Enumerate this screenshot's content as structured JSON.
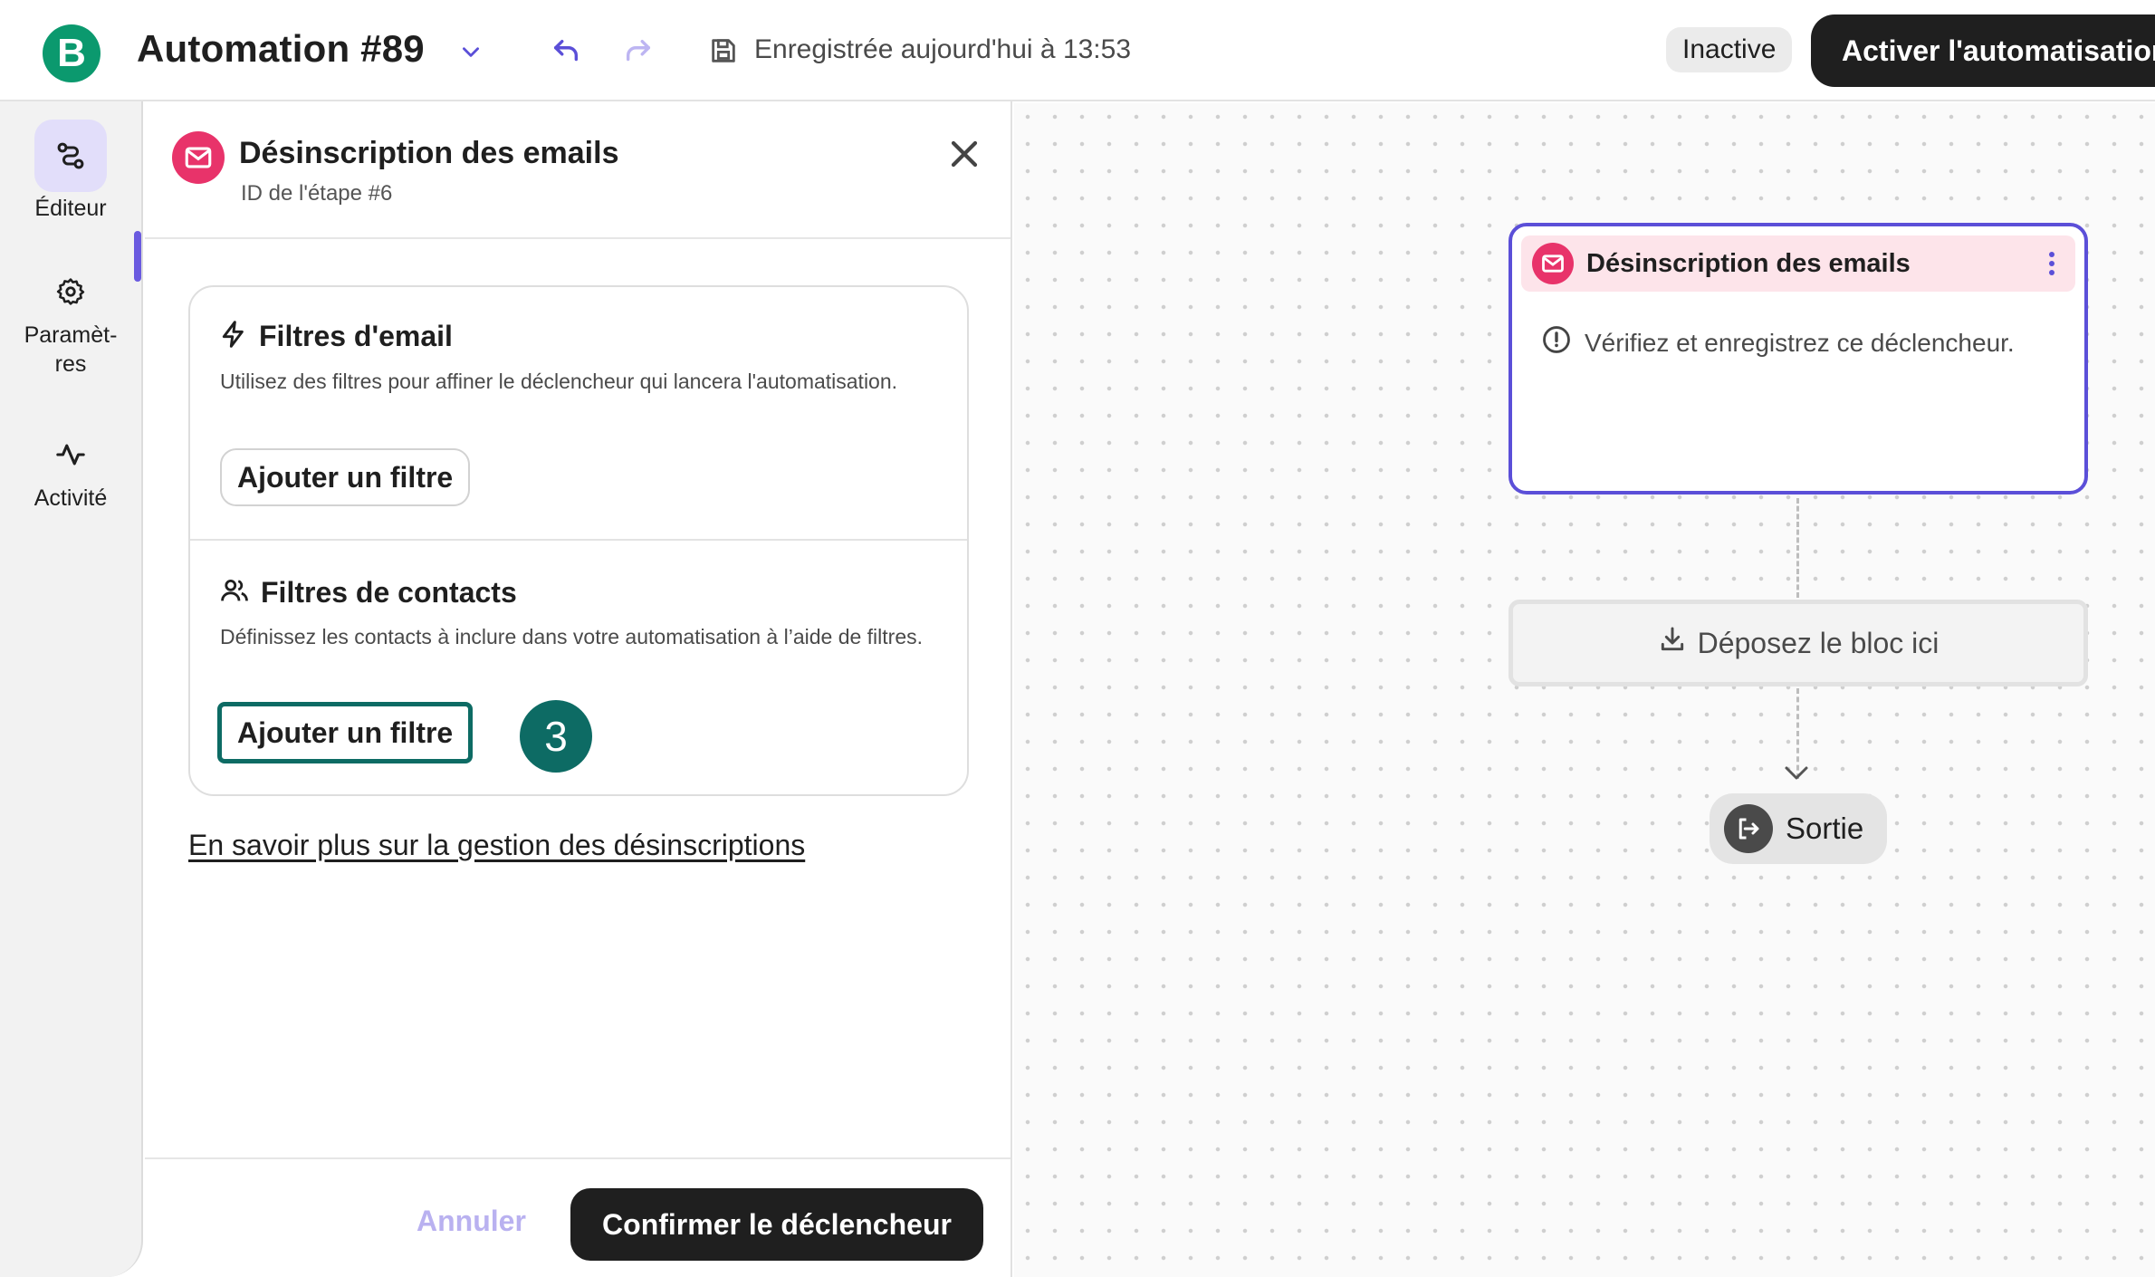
{
  "header": {
    "logo_letter": "B",
    "title": "Automation #89",
    "save_status": "Enregistrée aujourd'hui à 13:53",
    "status_badge": "Inactive",
    "activate_label": "Activer l'automatisation"
  },
  "sidebar": {
    "items": [
      {
        "label": "Éditeur",
        "icon": "workflow-icon",
        "active": true
      },
      {
        "label": "Paramèt-\nres",
        "icon": "gear-icon",
        "active": false
      },
      {
        "label": "Activité",
        "icon": "activity-icon",
        "active": false
      }
    ]
  },
  "panel": {
    "title": "Désinscription des emails",
    "subtitle": "ID de l'étape #6",
    "email_filters": {
      "title": "Filtres d'email",
      "description": "Utilisez des filtres pour affiner le déclencheur qui lancera l'automatisation.",
      "button_label": "Ajouter un filtre"
    },
    "contact_filters": {
      "title": "Filtres de contacts",
      "description": "Définissez les contacts à inclure dans votre automatisation à l’aide de filtres.",
      "button_label": "Ajouter un filtre",
      "step_badge": "3"
    },
    "learn_more_link": "En savoir plus sur la gestion des désinscriptions",
    "cancel_label": "Annuler",
    "confirm_label": "Confirmer le déclencheur"
  },
  "canvas": {
    "trigger_node": {
      "title": "Désinscription des emails",
      "warning": "Vérifiez et enregistrez ce déclencheur."
    },
    "drop_zone_label": "Déposez le bloc ici",
    "exit_label": "Sortie"
  },
  "colors": {
    "brand_green": "#0b996e",
    "accent_purple": "#5b4fd8",
    "email_pink": "#e8336a",
    "focus_teal": "#0d6b64"
  }
}
